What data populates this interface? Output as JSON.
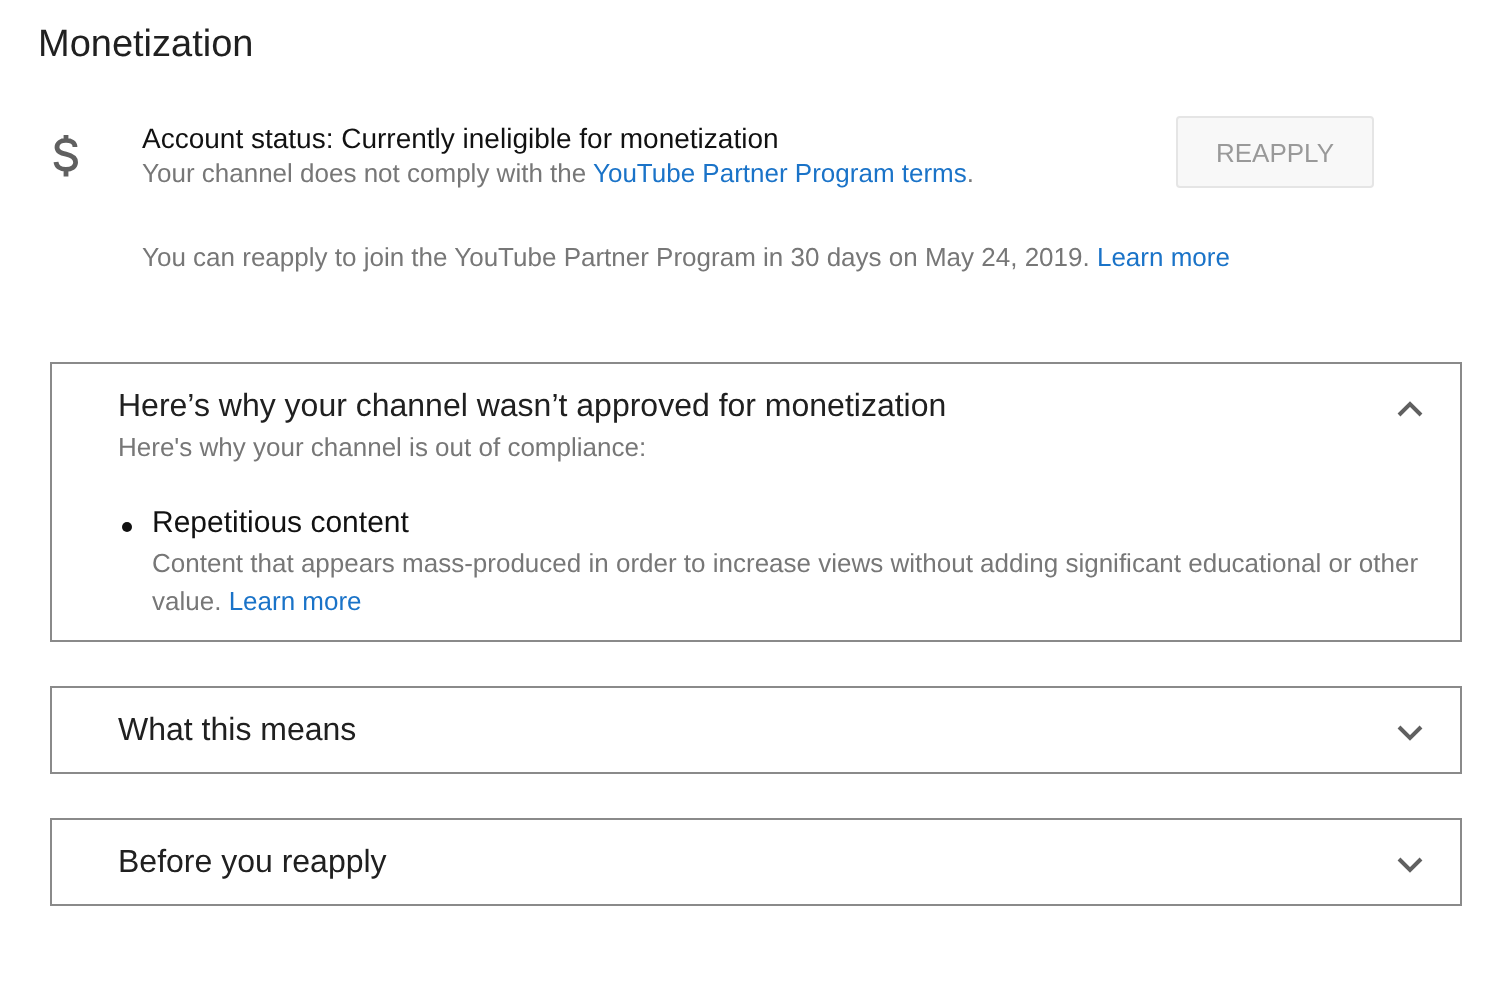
{
  "page_title": "Monetization",
  "account": {
    "status": "Account status: Currently ineligible for monetization",
    "note": {
      "text": "Your channel does not comply with the ",
      "link": "YouTube Partner Program terms",
      "after": "."
    },
    "button": {
      "label": "REAPPLY",
      "disabled": true
    },
    "reapply_note": {
      "text": "You can reapply to join the YouTube Partner Program in 30 days on May 24, 2019. ",
      "link": "Learn more"
    }
  },
  "panels": [
    {
      "title": "Here’s why your channel wasn’t approved for monetization",
      "expanded": true,
      "subtitle": "Here's why your channel is out of compliance:",
      "items": [
        {
          "title": "Repetitious content",
          "text": "Content that appears mass-produced in order to increase views without adding significant educational or other value. ",
          "link": "Learn more"
        }
      ]
    },
    {
      "title": "What this means",
      "expanded": false
    },
    {
      "title": "Before you reapply",
      "expanded": false
    }
  ]
}
